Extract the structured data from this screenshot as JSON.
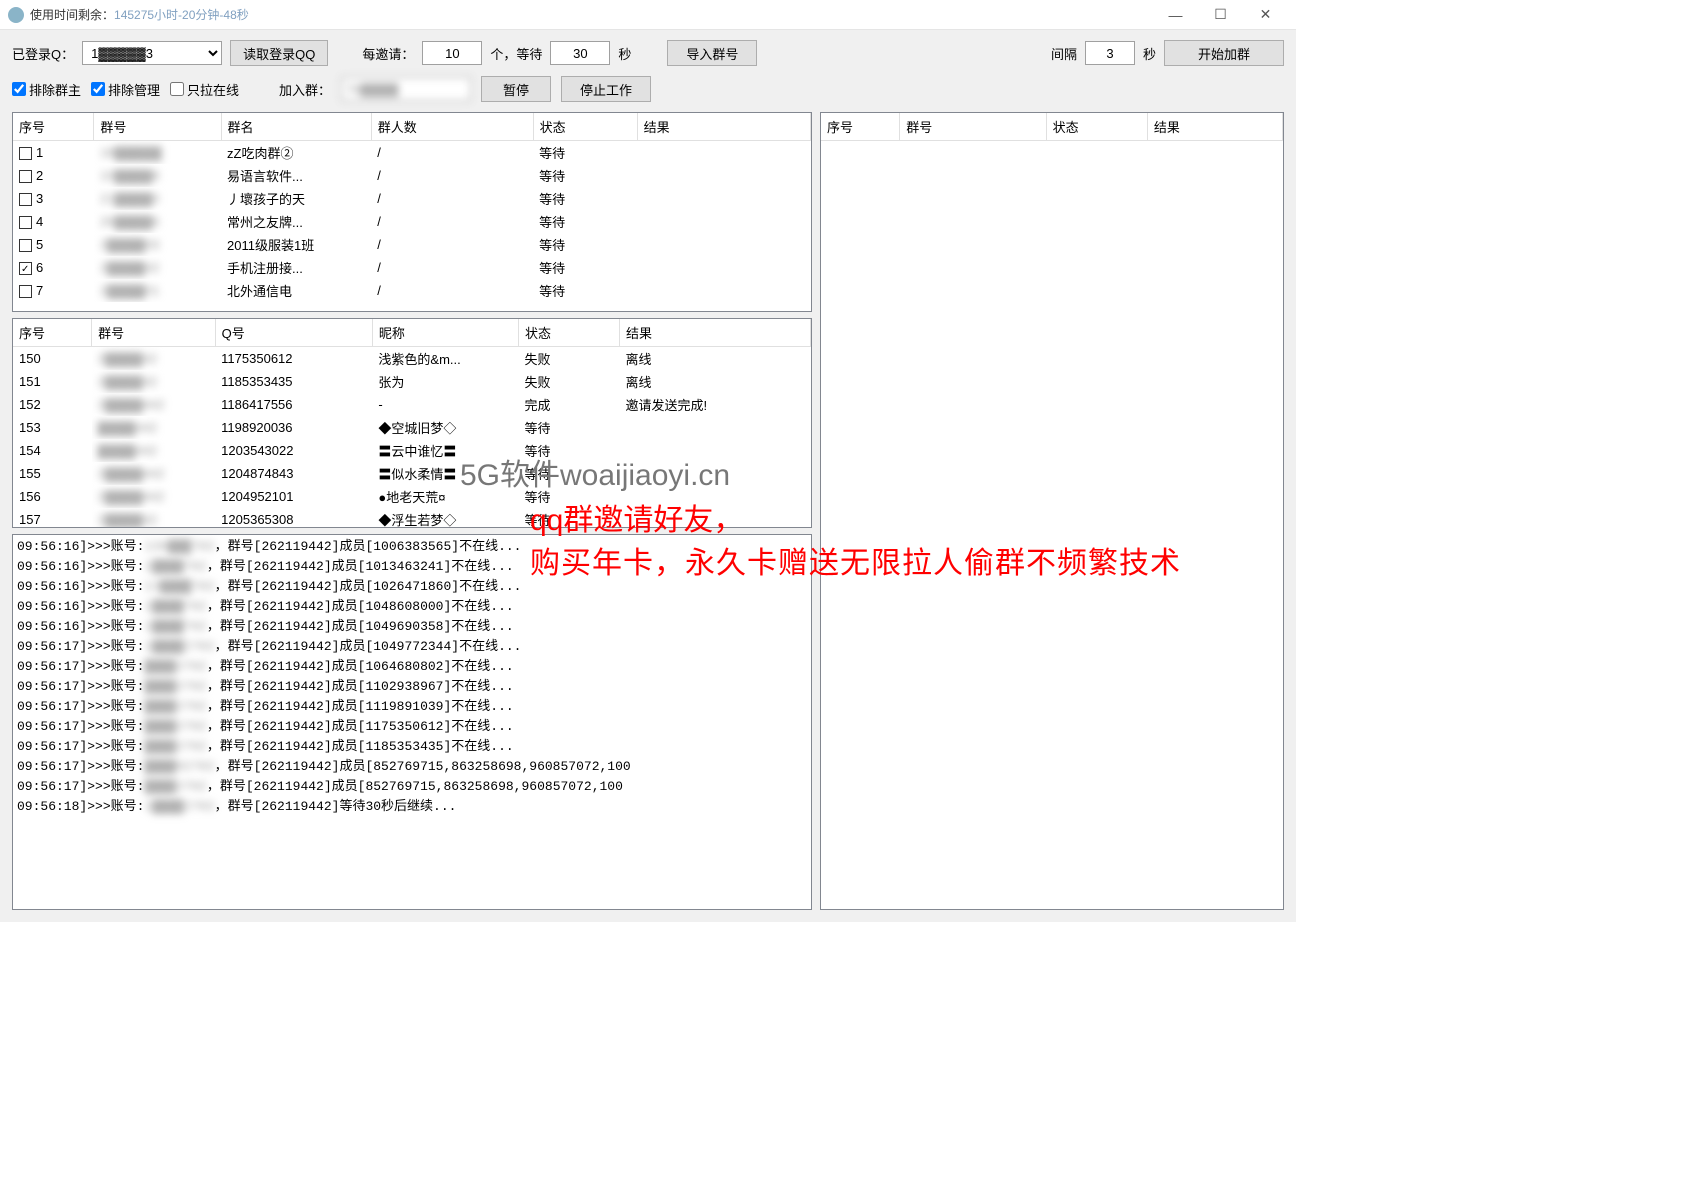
{
  "title": "使用时间剩余：",
  "title_time": "145275小时-20分钟-48秒",
  "toolbar": {
    "logged_label": "已登录Q：",
    "qq_sel": "1▓▓▓▓▓3",
    "read_login": "读取登录QQ",
    "each_invite": "每邀请：",
    "invite_count": "10",
    "unit_wait": "个，等待",
    "wait_sec": "30",
    "sec": "秒",
    "import_group": "导入群号",
    "interval": "间隔",
    "interval_sec": "3",
    "start_join": "开始加群",
    "exclude_owner": "排除群主",
    "exclude_admin": "排除管理",
    "only_online": "只拉在线",
    "join_group": "加入群：",
    "join_group_val": "79▓▓▓▓",
    "pause": "暂停",
    "stop": "停止工作"
  },
  "table1": {
    "headers": [
      "序号",
      "群号",
      "群名",
      "群人数",
      "状态",
      "结果"
    ],
    "rows": [
      {
        "chk": false,
        "seq": "1",
        "gid": "18▓▓▓▓▓",
        "name": "zZ吃肉群②",
        "cnt": "/",
        "st": "等待",
        "res": ""
      },
      {
        "chk": false,
        "seq": "2",
        "gid": "10▓▓▓▓8",
        "name": "易语言软件...",
        "cnt": "/",
        "st": "等待",
        "res": ""
      },
      {
        "chk": false,
        "seq": "3",
        "gid": "21▓▓▓▓0",
        "name": "丿壞孩子的天",
        "cnt": "/",
        "st": "等待",
        "res": ""
      },
      {
        "chk": false,
        "seq": "4",
        "gid": "26▓▓▓▓6",
        "name": "常州之友牌...",
        "cnt": "/",
        "st": "等待",
        "res": ""
      },
      {
        "chk": false,
        "seq": "5",
        "gid": "2▓▓▓▓93",
        "name": "2011级服装1班",
        "cnt": "/",
        "st": "等待",
        "res": ""
      },
      {
        "chk": true,
        "seq": "6",
        "gid": "2▓▓▓▓42",
        "name": "手机注册接...",
        "cnt": "/",
        "st": "等待",
        "res": ""
      },
      {
        "chk": false,
        "seq": "7",
        "gid": "2▓▓▓▓01",
        "name": "北外通信电",
        "cnt": "/",
        "st": "等待",
        "res": ""
      }
    ]
  },
  "table2": {
    "headers": [
      "序号",
      "群号",
      "Q号",
      "昵称",
      "状态",
      "结果"
    ],
    "rows": [
      {
        "seq": "150",
        "gid": "2▓▓▓▓42",
        "qq": "1175350612",
        "nick": "浅紫色的&m...",
        "st": "失败",
        "res": "离线"
      },
      {
        "seq": "151",
        "gid": "2▓▓▓▓42",
        "qq": "1185353435",
        "nick": "张为",
        "st": "失败",
        "res": "离线"
      },
      {
        "seq": "152",
        "gid": "2▓▓▓▓442",
        "qq": "1186417556",
        "nick": "-",
        "st": "完成",
        "res": "邀请发送完成!"
      },
      {
        "seq": "153",
        "gid": "▓▓▓▓442",
        "qq": "1198920036",
        "nick": "◆空城旧梦◇",
        "st": "等待",
        "res": ""
      },
      {
        "seq": "154",
        "gid": "▓▓▓▓442",
        "qq": "1203543022",
        "nick": "〓云中谁忆〓",
        "st": "等待",
        "res": ""
      },
      {
        "seq": "155",
        "gid": "2▓▓▓▓442",
        "qq": "1204874843",
        "nick": "〓似水柔情〓",
        "st": "等待",
        "res": ""
      },
      {
        "seq": "156",
        "gid": "2▓▓▓▓442",
        "qq": "1204952101",
        "nick": "●地老天荒¤",
        "st": "等待",
        "res": ""
      },
      {
        "seq": "157",
        "gid": "2▓▓▓▓42",
        "qq": "1205365308",
        "nick": "◆浮生若梦◇",
        "st": "等待",
        "res": ""
      }
    ]
  },
  "table3": {
    "headers": [
      "序号",
      "群号",
      "状态",
      "结果"
    ]
  },
  "log": [
    "09:56:16]>>>账号:139▓▓▓702，群号[262119442]成员[1006383565]不在线...",
    "09:56:16]>>>账号:1▓▓▓▓702，群号[262119442]成员[1013463241]不在线...",
    "09:56:16]>>>账号:13▓▓▓▓702，群号[262119442]成员[1026471860]不在线...",
    "09:56:16]>>>账号:1▓▓▓▓702，群号[262119442]成员[1048608000]不在线...",
    "09:56:16]>>>账号:1▓▓▓▓702，群号[262119442]成员[1049690358]不在线...",
    "09:56:17]>>>账号:1▓▓▓▓2702，群号[262119442]成员[1049772344]不在线...",
    "09:56:17]>>>账号:▓▓▓▓2702，群号[262119442]成员[1064680802]不在线...",
    "09:56:17]>>>账号:▓▓▓▓2702，群号[262119442]成员[1102938967]不在线...",
    "09:56:17]>>>账号:▓▓▓▓2702，群号[262119442]成员[1119891039]不在线...",
    "09:56:17]>>>账号:▓▓▓▓2702，群号[262119442]成员[1175350612]不在线...",
    "09:56:17]>>>账号:▓▓▓▓2702，群号[262119442]成员[1185353435]不在线...",
    "09:56:17]>>>账号:▓▓▓▓02702，群号[262119442]成员[852769715,863258698,960857072,100",
    "09:56:17]>>>账号:▓▓▓▓2702，群号[262119442]成员[852769715,863258698,960857072,100",
    "09:56:18]>>>账号:1▓▓▓▓2702，群号[262119442]等待30秒后继续..."
  ],
  "watermark": {
    "w1": "5G软件woaijiaoyi.cn",
    "w2": "qq群邀请好友，",
    "w3": "购买年卡，永久卡赠送无限拉人偷群不频繁技术"
  }
}
